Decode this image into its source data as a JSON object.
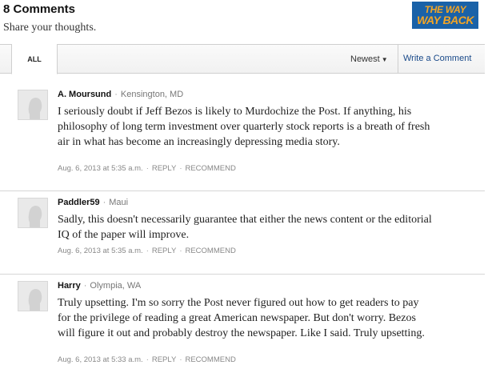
{
  "header": {
    "title": "8 Comments",
    "subtitle": "Share your thoughts."
  },
  "logo": {
    "line1": "THE WAY",
    "line2": "WAY BACK",
    "bg_color": "#1a62a8",
    "text_color": "#f5a524"
  },
  "tabs": {
    "all_label": "ALL",
    "sort_label": "Newest",
    "sort_caret": "▼",
    "write_label": "Write a Comment"
  },
  "comments": [
    {
      "author": "A. Moursund",
      "location": "Kensington, MD",
      "text": "I seriously doubt if Jeff Bezos is likely to Murdochize the Post. If anything, his philosophy of long term investment over quarterly stock reports is a breath of fresh air in what has become an increasingly depressing media story.",
      "date": "Aug. 6, 2013 at 5:35 a.m.",
      "reply_label": "REPLY",
      "recommend_label": "RECOMMEND"
    },
    {
      "author": "Paddler59",
      "location": "Maui",
      "text": "Sadly, this doesn't necessarily guarantee that either the news content or the editorial IQ of the paper will improve.",
      "date": "Aug. 6, 2013 at 5:35 a.m.",
      "reply_label": "REPLY",
      "recommend_label": "RECOMMEND"
    },
    {
      "author": "Harry",
      "location": "Olympia, WA",
      "text": "Truly upsetting. I'm so sorry the Post never figured out how to get readers to pay for the privilege of reading a great American newspaper. But don't worry. Bezos will figure it out and probably destroy the newspaper. Like I said. Truly upsetting.",
      "date": "Aug. 6, 2013 at 5:33 a.m.",
      "reply_label": "REPLY",
      "recommend_label": "RECOMMEND"
    }
  ],
  "separator": "·"
}
